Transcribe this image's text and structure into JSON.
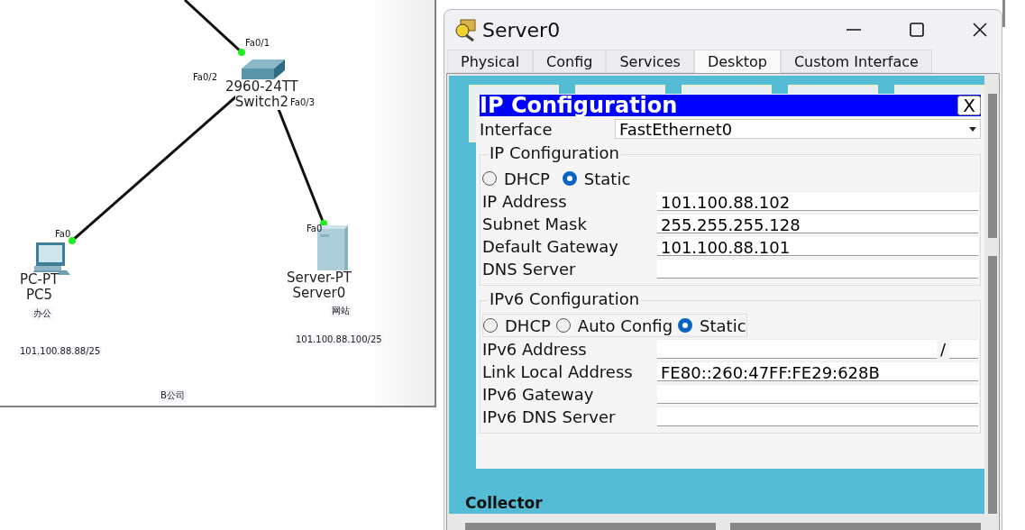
{
  "topology": {
    "devices": [
      {
        "kind": "switch",
        "model": "2960-24TT",
        "name": "Switch2"
      },
      {
        "kind": "pc",
        "model": "PC-PT",
        "name": "PC5"
      },
      {
        "kind": "server",
        "model": "Server-PT",
        "name": "Server0"
      }
    ],
    "ports": [
      "Fa0/1",
      "Fa0/2",
      "Fa0/3",
      "Fa0",
      "Fa0"
    ],
    "notes": [
      "办公",
      "101.100.88.88/25",
      "网站",
      "101.100.88.100/25",
      "B公司"
    ]
  },
  "window": {
    "title": "Server0",
    "tabs": [
      {
        "label": "Physical",
        "selected": false
      },
      {
        "label": "Config",
        "selected": false
      },
      {
        "label": "Services",
        "selected": false
      },
      {
        "label": "Desktop",
        "selected": true
      },
      {
        "label": "Custom Interface",
        "selected": false
      }
    ],
    "desktop_label": "Collector",
    "dialog": {
      "title": "IP Configuration",
      "close": "X",
      "interface_label": "Interface",
      "interface": "FastEthernet0",
      "ipv4": {
        "title": "IP Configuration",
        "modes": [
          {
            "label": "DHCP",
            "selected": false
          },
          {
            "label": "Static",
            "selected": true
          }
        ],
        "fields": [
          {
            "label": "IP Address",
            "value": "101.100.88.102"
          },
          {
            "label": "Subnet Mask",
            "value": "255.255.255.128"
          },
          {
            "label": "Default Gateway",
            "value": "101.100.88.101"
          },
          {
            "label": "DNS Server"
          }
        ]
      },
      "ipv6": {
        "title": "IPv6 Configuration",
        "modes": [
          {
            "label": "DHCP",
            "selected": false
          },
          {
            "label": "Auto Config",
            "selected": false
          },
          {
            "label": "Static",
            "selected": true
          }
        ],
        "prefix_separator": "/",
        "fields": [
          {
            "label": "IPv6 Address",
            "kind": "prefixed"
          },
          {
            "label": "Link Local Address",
            "value": "FE80::260:47FF:FE29:628B"
          },
          {
            "label": "IPv6 Gateway"
          },
          {
            "label": "IPv6 DNS Server"
          }
        ]
      }
    }
  }
}
